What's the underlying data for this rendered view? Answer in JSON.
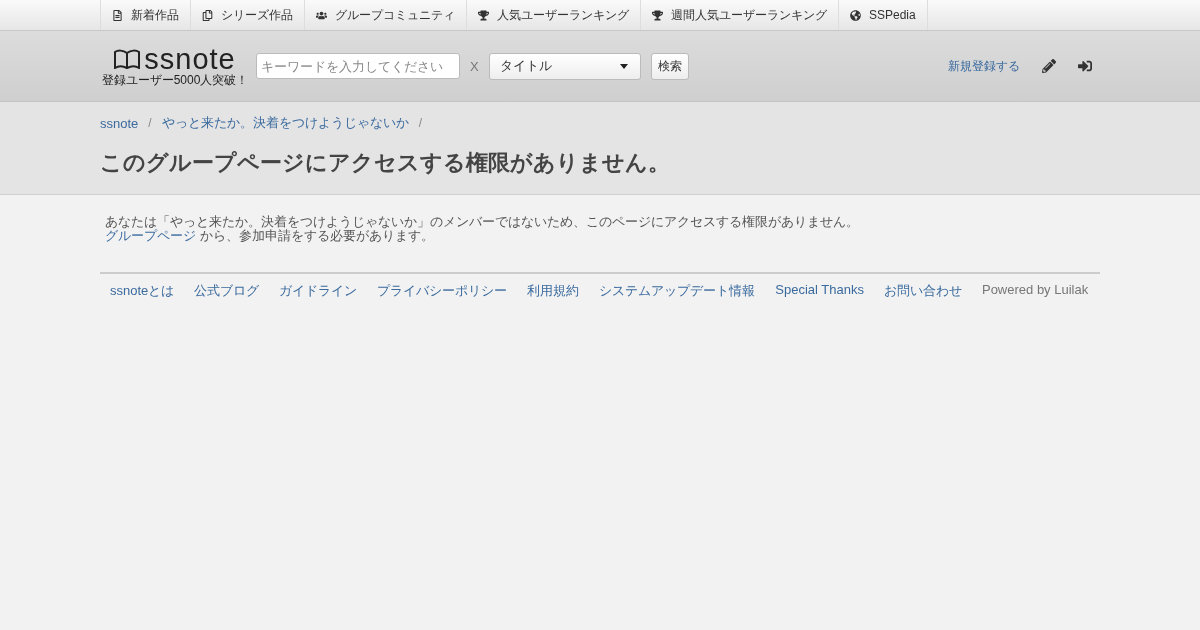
{
  "top_nav": [
    {
      "kind": "file",
      "label": "新着作品"
    },
    {
      "kind": "copy",
      "label": "シリーズ作品"
    },
    {
      "kind": "users",
      "label": "グループコミュニティ"
    },
    {
      "kind": "trophy",
      "label": "人気ユーザーランキング"
    },
    {
      "kind": "trophy",
      "label": "週間人気ユーザーランキング"
    },
    {
      "kind": "globe",
      "label": "SSPedia"
    }
  ],
  "header": {
    "logo": "ssnote",
    "tagline": "登録ユーザー5000人突破！",
    "search": {
      "placeholder": "キーワードを入力してください"
    },
    "clear": "X",
    "scope": "タイトル",
    "search_button": "検索",
    "register": "新規登録する"
  },
  "breadcrumb": [
    "ssnote",
    "やっと来たか。決着をつけようじゃないか"
  ],
  "breadcrumb_separator": "/",
  "title": "このグループページにアクセスする権限がありません。",
  "message": {
    "line1": "あなたは「やっと来たか。決着をつけようじゃないか」のメンバーではないため、このページにアクセスする権限がありません。",
    "link": "グループページ",
    "rest": "から、参加申請をする必要があります。"
  },
  "footer": {
    "links": [
      "ssnoteとは",
      "公式ブログ",
      "ガイドライン",
      "プライバシーポリシー",
      "利用規約",
      "システムアップデート情報",
      "Special Thanks",
      "お問い合わせ"
    ],
    "powered": "Powered by Luilak"
  }
}
